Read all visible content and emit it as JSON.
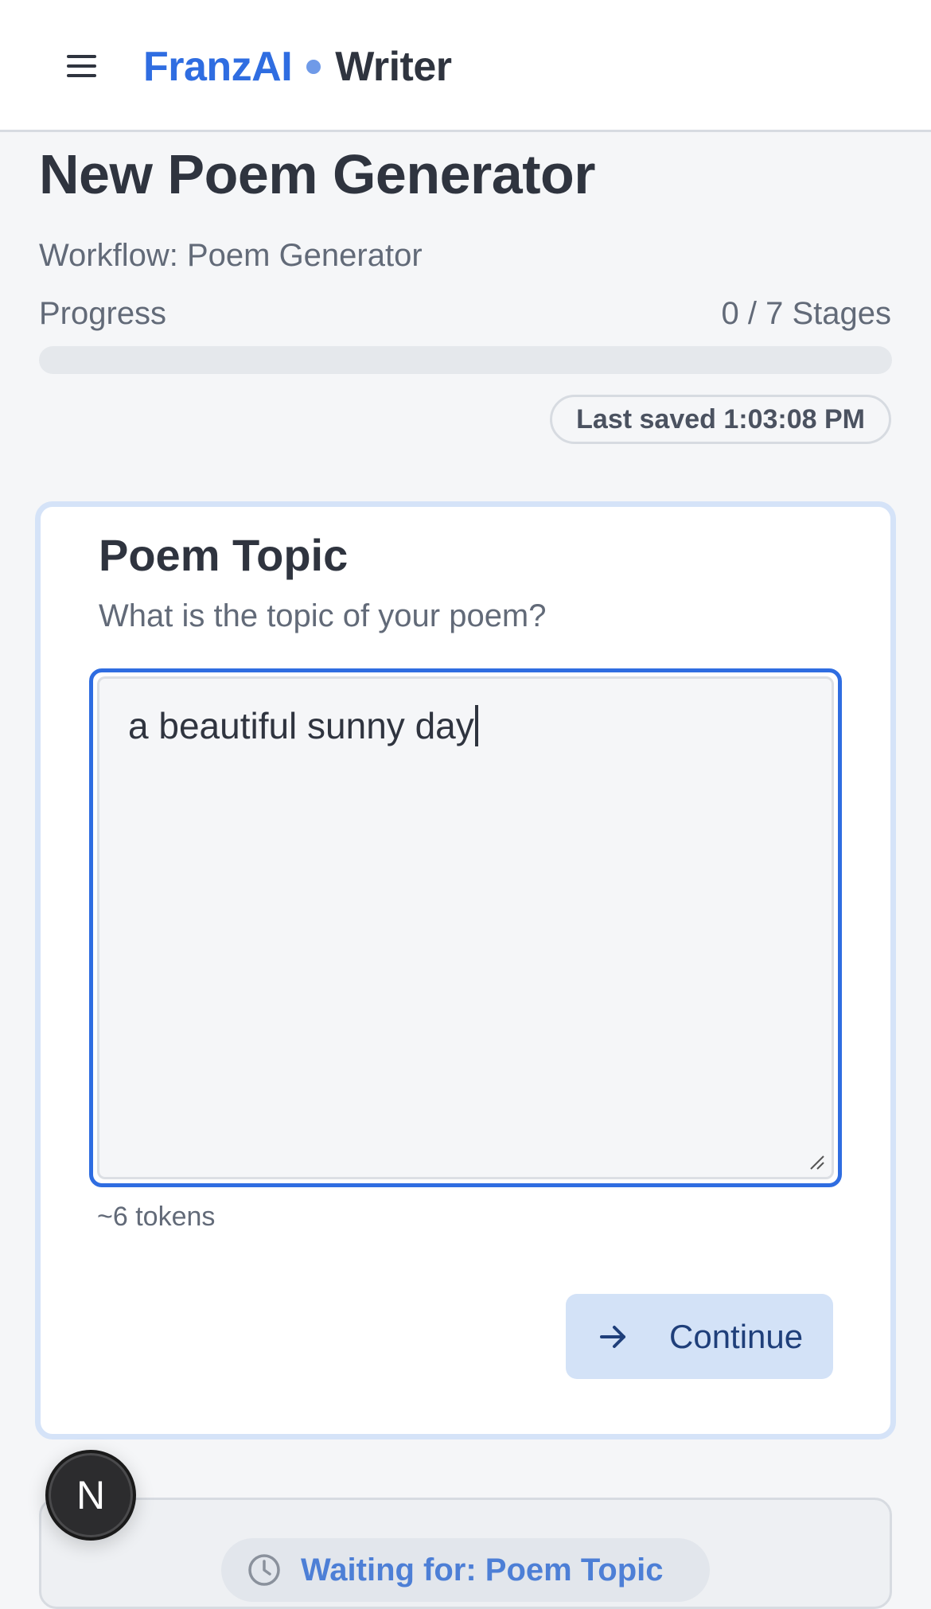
{
  "header": {
    "brand_primary": "FranzAI",
    "brand_secondary": "Writer",
    "menu_icon": "hamburger-menu-icon"
  },
  "page": {
    "title": "New Poem Generator",
    "workflow": "Workflow: Poem Generator",
    "progress_label": "Progress",
    "progress_count": "0 / 7 Stages",
    "progress_value": 0,
    "last_saved": "Last saved 1:03:08 PM"
  },
  "stage": {
    "title": "Poem Topic",
    "subtitle": "What is the topic of your poem?",
    "input_value": "a beautiful sunny day",
    "tokens": "~6 tokens",
    "continue_label": "Continue",
    "continue_icon": "arrow-right-icon"
  },
  "next_stage": {
    "waiting_text": "Waiting for: Poem Topic",
    "icon": "clock-icon"
  },
  "dev_badge": {
    "label": "N"
  },
  "colors": {
    "accent": "#2f6de1",
    "card_border": "#d5e3f8",
    "button_bg": "#d3e2f7",
    "text_primary": "#2f343f",
    "text_muted": "#626a78"
  }
}
